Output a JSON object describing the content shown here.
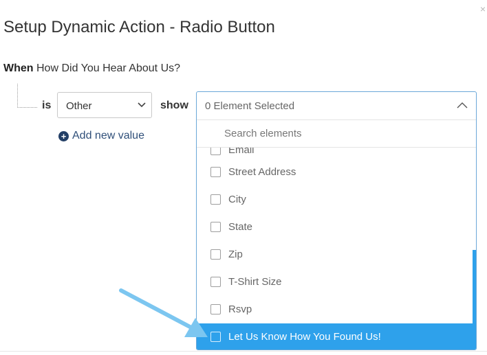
{
  "dialog": {
    "title": "Setup Dynamic Action - Radio Button",
    "close_glyph": "×"
  },
  "condition": {
    "when_label": "When",
    "field_name": "How Did You Hear About Us?",
    "is_label": "is",
    "selected_value": "Other",
    "show_label": "show",
    "add_value_label": "Add new value"
  },
  "element_dropdown": {
    "selected_text": "0 Element Selected",
    "search_placeholder": "Search elements",
    "items": [
      {
        "label": "Email",
        "checked": false
      },
      {
        "label": "Street Address",
        "checked": false
      },
      {
        "label": "City",
        "checked": false
      },
      {
        "label": "State",
        "checked": false
      },
      {
        "label": "Zip",
        "checked": false
      },
      {
        "label": "T-Shirt Size",
        "checked": false
      },
      {
        "label": "Rsvp",
        "checked": false
      },
      {
        "label": "Let Us Know How You Found Us!",
        "checked": false,
        "highlighted": true
      }
    ]
  },
  "icons": {
    "select_chevron": "chevron-down-icon",
    "dropdown_chevron": "chevron-up-icon",
    "add": "plus-circle-icon",
    "close": "close-icon",
    "annotation": "arrow-annotation-icon"
  },
  "colors": {
    "highlight": "#2ea1eb",
    "dropdown_border": "#6aa7d8",
    "add_link": "#2f4f79",
    "arrow": "#7cc6f0"
  }
}
